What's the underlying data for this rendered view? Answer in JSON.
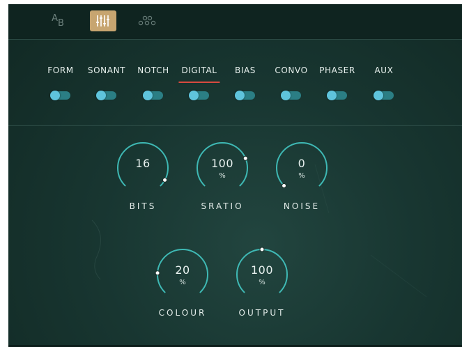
{
  "toolbar": {
    "ab_a": "A",
    "ab_b": "B",
    "buttons": [
      {
        "name": "ab-compare-icon",
        "active": false
      },
      {
        "name": "mixer-sliders-icon",
        "active": true
      },
      {
        "name": "nodes-icon",
        "active": false
      }
    ]
  },
  "tabs": [
    {
      "label": "FORM",
      "active": false
    },
    {
      "label": "SONANT",
      "active": false
    },
    {
      "label": "NOTCH",
      "active": false
    },
    {
      "label": "DIGITAL",
      "active": true
    },
    {
      "label": "BIAS",
      "active": false
    },
    {
      "label": "CONVO",
      "active": false
    },
    {
      "label": "PHASER",
      "active": false
    },
    {
      "label": "AUX",
      "active": false
    }
  ],
  "knobs": [
    {
      "label": "BITS",
      "value": "16",
      "unit": "",
      "level": 0.94
    },
    {
      "label": "SRATIO",
      "value": "100",
      "unit": "%",
      "level": 0.75
    },
    {
      "label": "NOISE",
      "value": "0",
      "unit": "%",
      "level": 0.0
    },
    {
      "label": "COLOUR",
      "value": "20",
      "unit": "%",
      "level": 0.18
    },
    {
      "label": "OUTPUT",
      "value": "100",
      "unit": "%",
      "level": 0.5
    }
  ],
  "colors": {
    "accent": "#43c6c2",
    "active_tab_underline": "#d84a3f",
    "active_toolbar": "#c7a570",
    "toggle_on": "#5fc4dc"
  }
}
